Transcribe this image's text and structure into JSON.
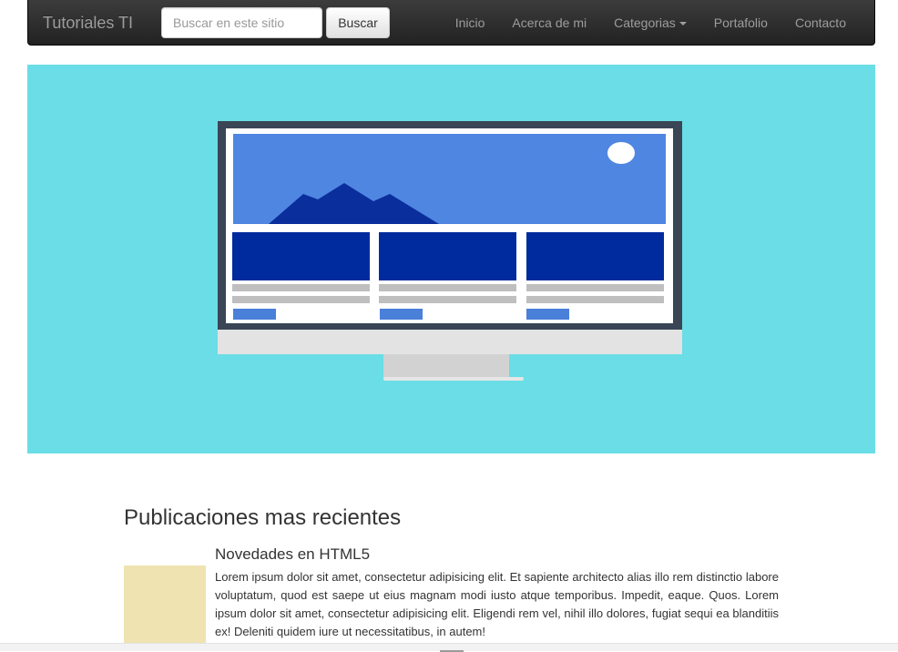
{
  "navbar": {
    "brand": "Tutoriales TI",
    "search": {
      "placeholder": "Buscar en este sitio",
      "value": ""
    },
    "search_button": "Buscar",
    "links": [
      {
        "label": "Inicio"
      },
      {
        "label": "Acerca de mi"
      },
      {
        "label": "Categorias",
        "dropdown": true
      },
      {
        "label": "Portafolio"
      },
      {
        "label": "Contacto"
      }
    ]
  },
  "hero": {
    "background": "#6adde6",
    "image": "monitor-illustration"
  },
  "main": {
    "section_title": "Publicaciones mas recientes",
    "posts": [
      {
        "title": "Novedades en HTML5",
        "excerpt": "Lorem ipsum dolor sit amet, consectetur adipisicing elit. Et sapiente architecto alias illo rem distinctio labore voluptatum, quod est saepe ut eius magnam modi iusto atque temporibus. Impedit, eaque. Quos. Lorem ipsum dolor sit amet, consectetur adipisicing elit. Eligendi rem vel, nihil illo dolores, fugiat sequi ea blanditiis ex! Deleniti quidem iure ut necessitatibus, in autem!",
        "thumb_color": "#efe3b2"
      }
    ]
  }
}
